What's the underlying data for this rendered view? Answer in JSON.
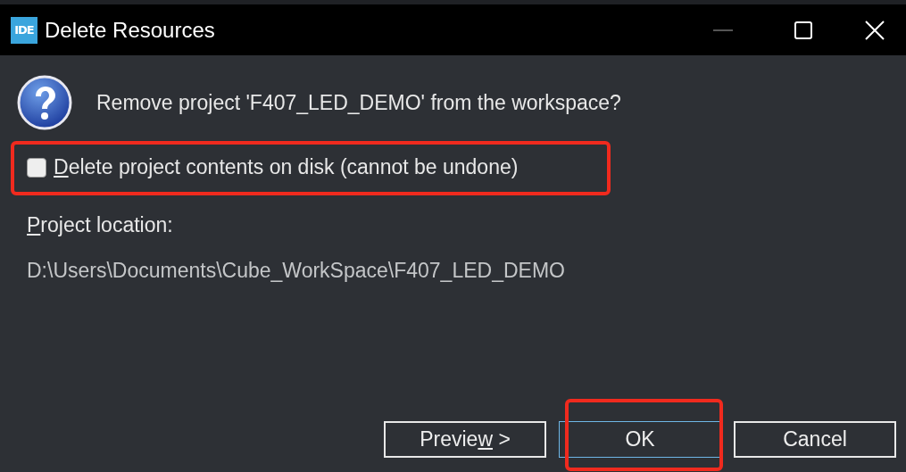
{
  "window": {
    "title": "Delete Resources",
    "app_icon": "IDE",
    "minimize_disabled": true
  },
  "message": "Remove project 'F407_LED_DEMO' from the workspace?",
  "checkbox": {
    "mnemonic": "D",
    "label_rest": "elete project contents on disk (cannot be undone)",
    "checked": false,
    "highlighted": true
  },
  "location_label": {
    "mnemonic": "P",
    "label_rest": "roject location:"
  },
  "location_path": "D:\\Users\\Documents\\Cube_WorkSpace\\F407_LED_DEMO",
  "buttons": [
    {
      "label_before": "Previe",
      "mnemonic": "w",
      "label_rest": " >",
      "focused": false,
      "highlighted": false
    },
    {
      "label_rest": "OK",
      "focused": true,
      "highlighted": true
    },
    {
      "label_rest": "Cancel",
      "focused": false,
      "highlighted": false
    }
  ]
}
